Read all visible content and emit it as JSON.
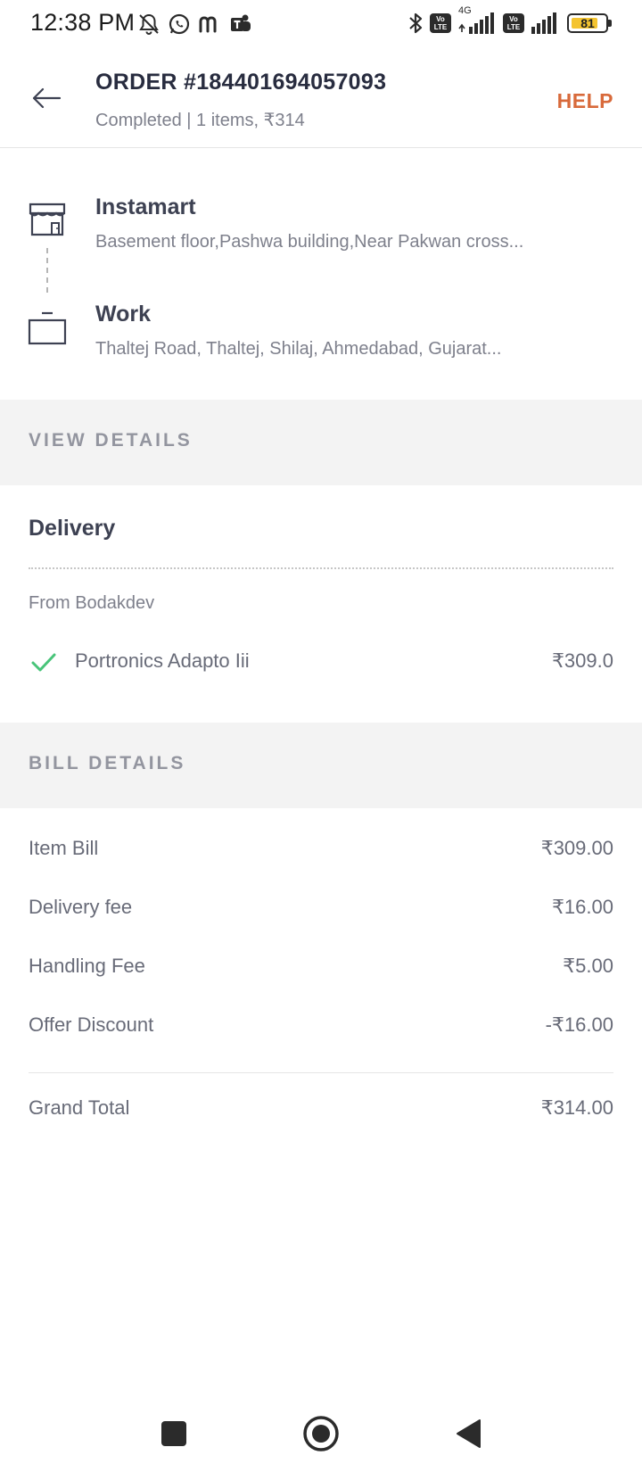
{
  "status_bar": {
    "time": "12:38 PM",
    "network_label": "4G",
    "lte_label": "Vo LTE",
    "battery": "81",
    "battery_level": 0.81,
    "icons": [
      "bell-off-icon",
      "whatsapp-icon",
      "m-app-icon",
      "teams-icon",
      "bluetooth-icon",
      "volte-icon",
      "signal-icon",
      "volte-icon",
      "signal-icon",
      "battery-icon"
    ]
  },
  "header": {
    "title": "ORDER #184401694057093",
    "subtitle": "Completed | 1 items, ₹314",
    "help_label": "HELP"
  },
  "pickup": {
    "name": "Instamart",
    "address": "Basement floor,Pashwa building,Near Pakwan cross..."
  },
  "dropoff": {
    "name": "Work",
    "address": "Thaltej Road, Thaltej, Shilaj, Ahmedabad, Gujarat..."
  },
  "view_details": {
    "label": "VIEW DETAILS"
  },
  "delivery": {
    "title": "Delivery",
    "from_label": "From Bodakdev",
    "items": [
      {
        "name": "Portronics Adapto Iii",
        "price": "₹309.0"
      }
    ]
  },
  "bill": {
    "label": "BILL DETAILS",
    "rows": [
      {
        "label": "Item Bill",
        "value": "₹309.00"
      },
      {
        "label": "Delivery fee",
        "value": "₹16.00"
      },
      {
        "label": "Handling Fee",
        "value": "₹5.00"
      },
      {
        "label": "Offer Discount",
        "value": "-₹16.00"
      }
    ],
    "grand_total_label": "Grand Total",
    "grand_total_value": "₹314.00"
  },
  "colors": {
    "accent": "#d86a3b",
    "check": "#48c479",
    "section_bg": "#f3f3f3"
  }
}
